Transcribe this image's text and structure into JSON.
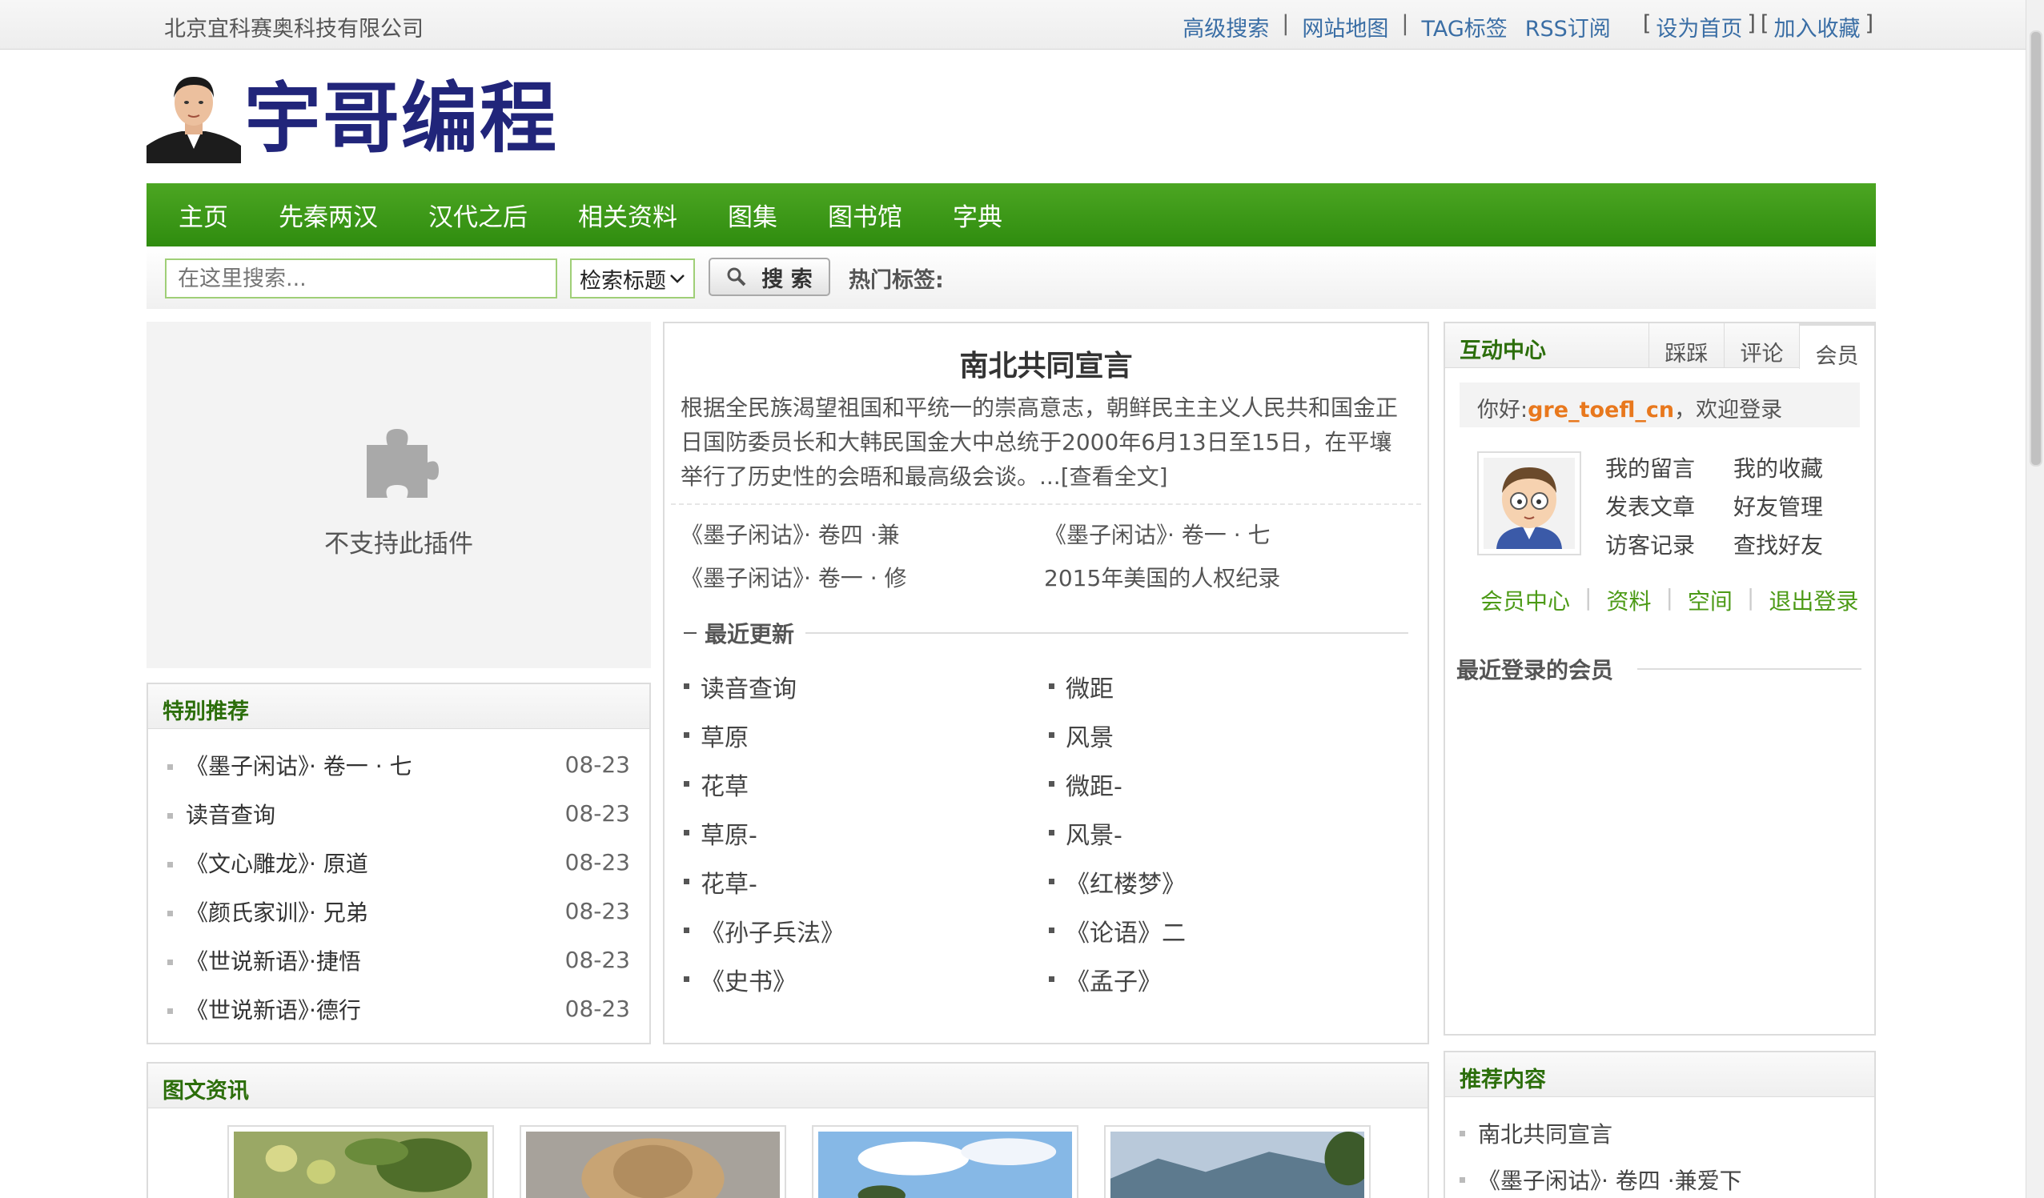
{
  "topbar": {
    "company": "北京宜科赛奥科技有限公司",
    "links": [
      "高级搜索",
      "网站地图",
      "TAG标签",
      "RSS订阅"
    ],
    "set_home": "设为首页",
    "add_fav": "加入收藏",
    "lbracket": "[",
    "rbracket": "]",
    "sep": "|"
  },
  "header": {
    "logo_text": "宇哥编程"
  },
  "nav": {
    "items": [
      "主页",
      "先秦两汉",
      "汉代之后",
      "相关资料",
      "图集",
      "图书馆",
      "字典"
    ]
  },
  "search": {
    "placeholder": "在这里搜索...",
    "select_value": "检索标题",
    "button": "搜 索",
    "hot_tags_label": "热门标签:"
  },
  "plugin": {
    "message": "不支持此插件"
  },
  "special": {
    "title": "特别推荐",
    "items": [
      {
        "title": "《墨子闲诂》· 卷一 · 七",
        "date": "08-23"
      },
      {
        "title": "读音查询",
        "date": "08-23"
      },
      {
        "title": "《文心雕龙》· 原道",
        "date": "08-23"
      },
      {
        "title": "《颜氏家训》· 兄弟",
        "date": "08-23"
      },
      {
        "title": "《世说新语》·捷悟",
        "date": "08-23"
      },
      {
        "title": "《世说新语》·德行",
        "date": "08-23"
      }
    ]
  },
  "headline": {
    "title": "南北共同宣言",
    "intro": "根据全民族渴望祖国和平统一的崇高意志，朝鲜民主主义人民共和国金正日国防委员长和大韩民国金大中总统于2000年6月13日至15日，在平壤举行了历史性的会晤和最高级会谈。...",
    "more": "[查看全文]",
    "links": [
      "《墨子闲诂》· 卷四 ·兼",
      "《墨子闲诂》· 卷一 · 七",
      "《墨子闲诂》· 卷一 · 修",
      "2015年美国的人权纪录"
    ]
  },
  "updates": {
    "title": "最近更新",
    "items": [
      "读音查询",
      "微距",
      "草原",
      "风景",
      "花草",
      "微距-",
      "草原-",
      "风景-",
      "花草-",
      "《红楼梦》",
      "《孙子兵法》",
      "《论语》二",
      "《史书》",
      "《孟子》"
    ]
  },
  "interact": {
    "title": "互动中心",
    "tabs": [
      "踩踩",
      "评论",
      "会员"
    ],
    "hello_prefix": "你好:",
    "username": "gre_toefl_cn",
    "hello_suffix": "，欢迎登录",
    "links": [
      "我的留言",
      "我的收藏",
      "发表文章",
      "好友管理",
      "访客记录",
      "查找好友"
    ],
    "actions": [
      "会员中心",
      "资料",
      "空间",
      "退出登录"
    ],
    "action_sep": "|",
    "recent_login": "最近登录的会员"
  },
  "news": {
    "title": "图文资讯"
  },
  "recommend": {
    "title": "推荐内容",
    "items": [
      "南北共同宣言",
      "《墨子闲诂》· 卷四 ·兼爱下"
    ]
  }
}
